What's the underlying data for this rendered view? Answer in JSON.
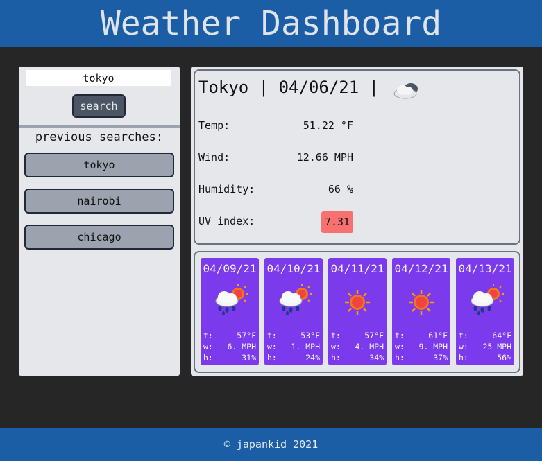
{
  "header": {
    "title": "Weather Dashboard"
  },
  "sidebar": {
    "search_value": "tokyo",
    "search_button": "search",
    "previous_title": "previous searches:",
    "history": [
      "tokyo",
      "nairobi",
      "chicago"
    ]
  },
  "current": {
    "city": "Tokyo",
    "date": "04/06/21",
    "icon": "cloudy-icon",
    "temp_label": "Temp:",
    "temp_value": "51.22 °F",
    "wind_label": "Wind:",
    "wind_value": "12.66 MPH",
    "humidity_label": "Humidity:",
    "humidity_value": "66 %",
    "uv_label": "UV index:",
    "uv_value": "7.31",
    "uv_color": "#f87171"
  },
  "forecast": [
    {
      "date": "04/09/21",
      "icon": "rain-sun-icon",
      "t": "57°F",
      "w": "6. MPH",
      "h": "31%"
    },
    {
      "date": "04/10/21",
      "icon": "rain-sun-icon",
      "t": "53°F",
      "w": "1. MPH",
      "h": "24%"
    },
    {
      "date": "04/11/21",
      "icon": "sun-icon",
      "t": "57°F",
      "w": "4. MPH",
      "h": "34%"
    },
    {
      "date": "04/12/21",
      "icon": "sun-icon",
      "t": "61°F",
      "w": "9. MPH",
      "h": "37%"
    },
    {
      "date": "04/13/21",
      "icon": "rain-sun-icon",
      "t": "64°F",
      "w": "25 MPH",
      "h": "56%"
    }
  ],
  "forecast_labels": {
    "t": "t:",
    "w": "w:",
    "h": "h:"
  },
  "footer": {
    "text": "© japankid 2021"
  },
  "colors": {
    "header": "#1b5ea6",
    "card": "#7c3aed",
    "background": "#262626"
  }
}
